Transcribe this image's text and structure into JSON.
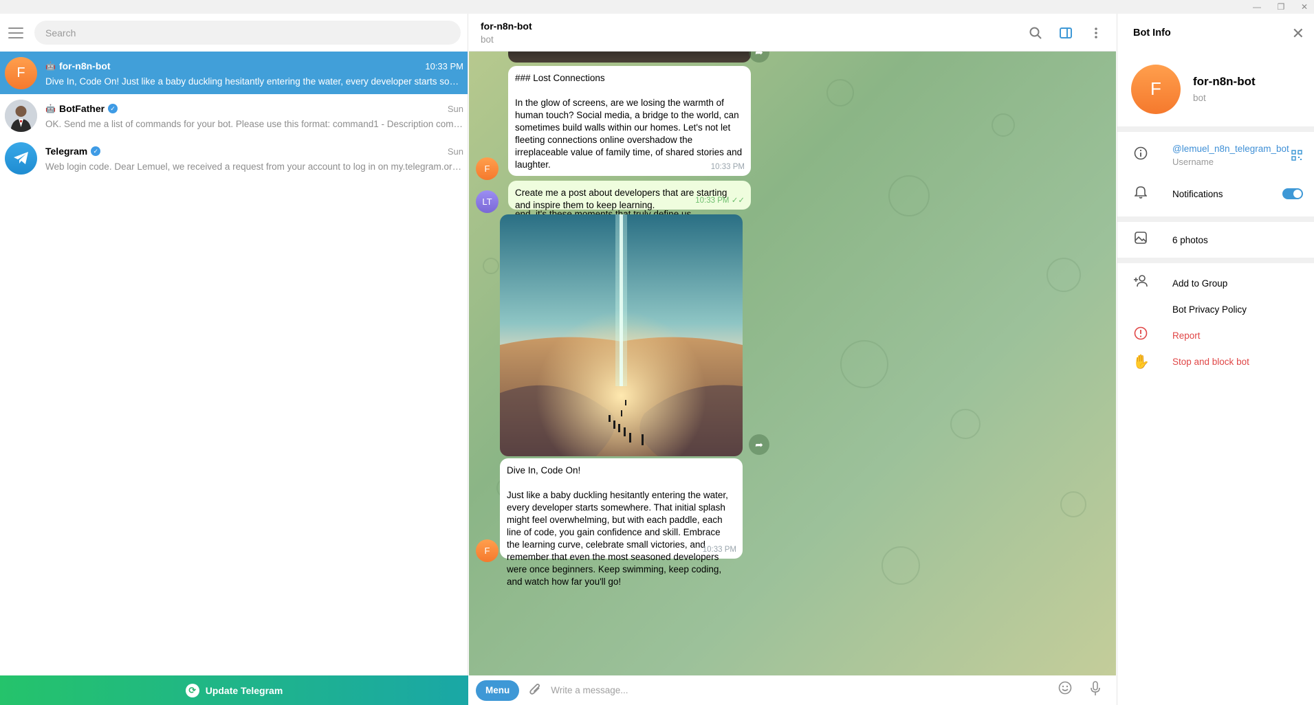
{
  "window": {
    "minimize_glyph": "—",
    "restore_glyph": "❐",
    "close_glyph": "✕"
  },
  "search": {
    "placeholder": "Search"
  },
  "chats": [
    {
      "name": "for-n8n-bot",
      "avatar_letter": "F",
      "time": "10:33 PM",
      "preview": "Dive In, Code On!  Just like a baby duckling hesitantly entering the water, every developer starts some..."
    },
    {
      "name": "BotFather",
      "time": "Sun",
      "preview": "OK. Send me a list of commands for your bot. Please use this format:  command1 - Description comm..."
    },
    {
      "name": "Telegram",
      "time": "Sun",
      "preview": "Web login code. Dear Lemuel, we received a request from your account to log in on my.telegram.org. ..."
    }
  ],
  "update_bar": {
    "label": "Update Telegram"
  },
  "header": {
    "title": "for-n8n-bot",
    "subtitle": "bot"
  },
  "messages": [
    {
      "text": "### Lost Connections\n\nIn the glow of screens, are we losing the warmth of human touch? Social media, a bridge to the world, can sometimes build walls within our homes. Let's not let fleeting connections online overshadow the irreplaceable value of family time, of shared stories and laughter.\n\nLook up, reconnect, and rediscover the joy of being together, present in each other's lives. Because in the end, it's these moments that truly define us.",
      "time": "10:33 PM",
      "avatar": "F"
    },
    {
      "text": "Create me a post about developers that are starting and inspire them to keep learning.",
      "time": "10:33 PM",
      "avatar": "LT"
    },
    {
      "text": "Dive In, Code On!\n\nJust like a baby duckling hesitantly entering the water, every developer starts somewhere. That initial splash might feel overwhelming, but with each paddle, each line of code, you gain confidence and skill. Embrace the learning curve, celebrate small victories, and remember that even the most seasoned developers were once beginners. Keep swimming, keep coding, and watch how far you'll go!",
      "time": "10:33 PM",
      "avatar": "F"
    }
  ],
  "composer": {
    "menu_label": "Menu",
    "placeholder": "Write a message..."
  },
  "bot_info": {
    "title": "Bot Info",
    "name": "for-n8n-bot",
    "avatar_letter": "F",
    "subtitle": "bot",
    "username": "@lemuel_n8n_telegram_bot",
    "username_label": "Username",
    "notifications_label": "Notifications",
    "notifications_on": true,
    "photos_label": "6 photos",
    "add_to_group": "Add to Group",
    "privacy_policy": "Bot Privacy Policy",
    "report": "Report",
    "stop_block": "Stop and block bot"
  },
  "colors": {
    "accent": "#419fd9",
    "danger": "#e04646",
    "update_start": "#25c36b",
    "update_end": "#1aa7a6"
  }
}
